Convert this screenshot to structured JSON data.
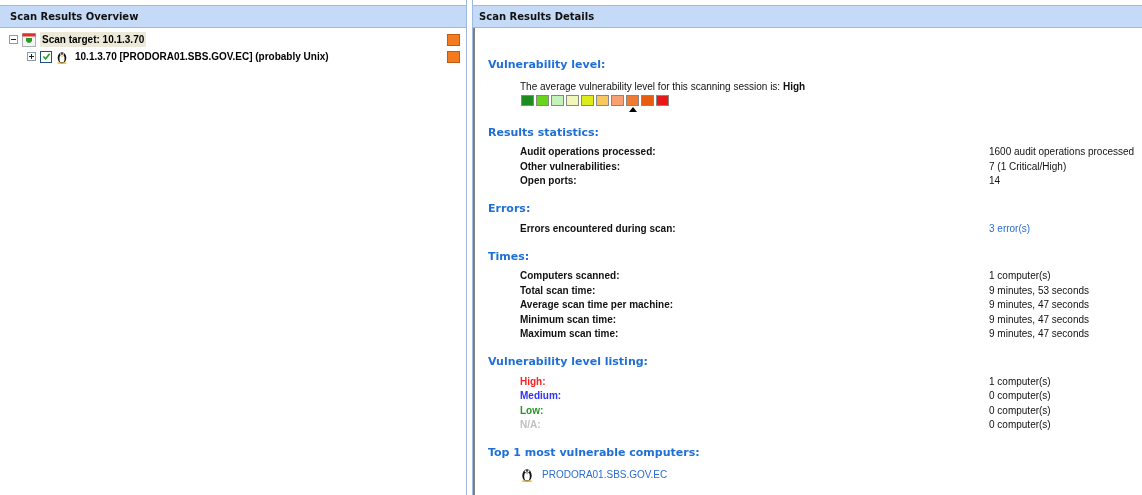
{
  "left_panel": {
    "title": "Scan Results Overview",
    "tree": [
      {
        "label": "Scan target: 10.1.3.70",
        "kind": "target",
        "expanded": true,
        "selected": true,
        "color": "#f47a20",
        "children": [
          {
            "label": "10.1.3.70 [PRODORA01.SBS.GOV.EC] (probably Unix)",
            "kind": "host",
            "expanded": false,
            "checked": true,
            "selected": false,
            "color": "#f47a20"
          }
        ]
      }
    ]
  },
  "right_panel": {
    "title": "Scan Results Details",
    "sections": [
      {
        "heading": "Vulnerability level:",
        "kind": "scale",
        "sentence": "The average vulnerability level for this scanning session is: **High**",
        "scale": [
          {
            "color": "#1e8c1e",
            "selected": false
          },
          {
            "color": "#66d61a",
            "selected": false
          },
          {
            "color": "#c4f2b8",
            "selected": false
          },
          {
            "color": "#f2f6b8",
            "selected": false
          },
          {
            "color": "#dcec1a",
            "selected": false
          },
          {
            "color": "#f8c860",
            "selected": false
          },
          {
            "color": "#f8a070",
            "selected": false
          },
          {
            "color": "#f07a30",
            "selected": true
          },
          {
            "color": "#e85c10",
            "selected": false
          },
          {
            "color": "#e81818",
            "selected": false
          }
        ]
      },
      {
        "heading": "Results statistics:",
        "kind": "rows",
        "rows": [
          {
            "label": "Audit operations processed:",
            "value": "1600 audit operations processed"
          },
          {
            "label": "Other vulnerabilities:",
            "value": "7 (1 Critical/High)"
          },
          {
            "label": "Open ports:",
            "value": "14"
          }
        ]
      },
      {
        "heading": "Errors:",
        "kind": "rows",
        "rows": [
          {
            "label": "Errors encountered during scan:",
            "value": "3 error(s)",
            "link": true
          }
        ]
      },
      {
        "heading": "Times:",
        "kind": "rows",
        "rows": [
          {
            "label": "Computers scanned:",
            "value": "1 computer(s)"
          },
          {
            "label": "Total scan time:",
            "value": "9 minutes, 53 seconds"
          },
          {
            "label": "Average scan time per machine:",
            "value": "9 minutes, 47 seconds"
          },
          {
            "label": "Minimum scan time:",
            "value": "9 minutes, 47 seconds"
          },
          {
            "label": "Maximum scan time:",
            "value": "9 minutes, 47 seconds"
          }
        ]
      },
      {
        "heading": "Vulnerability level listing:",
        "kind": "rows",
        "rows": [
          {
            "label": "High:",
            "value": "1 computer(s)",
            "color": "#ff2020"
          },
          {
            "label": "Medium:",
            "value": "0 computer(s)",
            "color": "#3030ff"
          },
          {
            "label": "Low:",
            "value": "0 computer(s)",
            "color": "#229922"
          },
          {
            "label": "N/A:",
            "value": "0 computer(s)",
            "color": "#c0c0c0"
          }
        ]
      },
      {
        "heading": "Top 1 most vulnerable computers:",
        "kind": "computers",
        "computers": [
          "PRODORA01.SBS.GOV.EC"
        ]
      }
    ]
  }
}
